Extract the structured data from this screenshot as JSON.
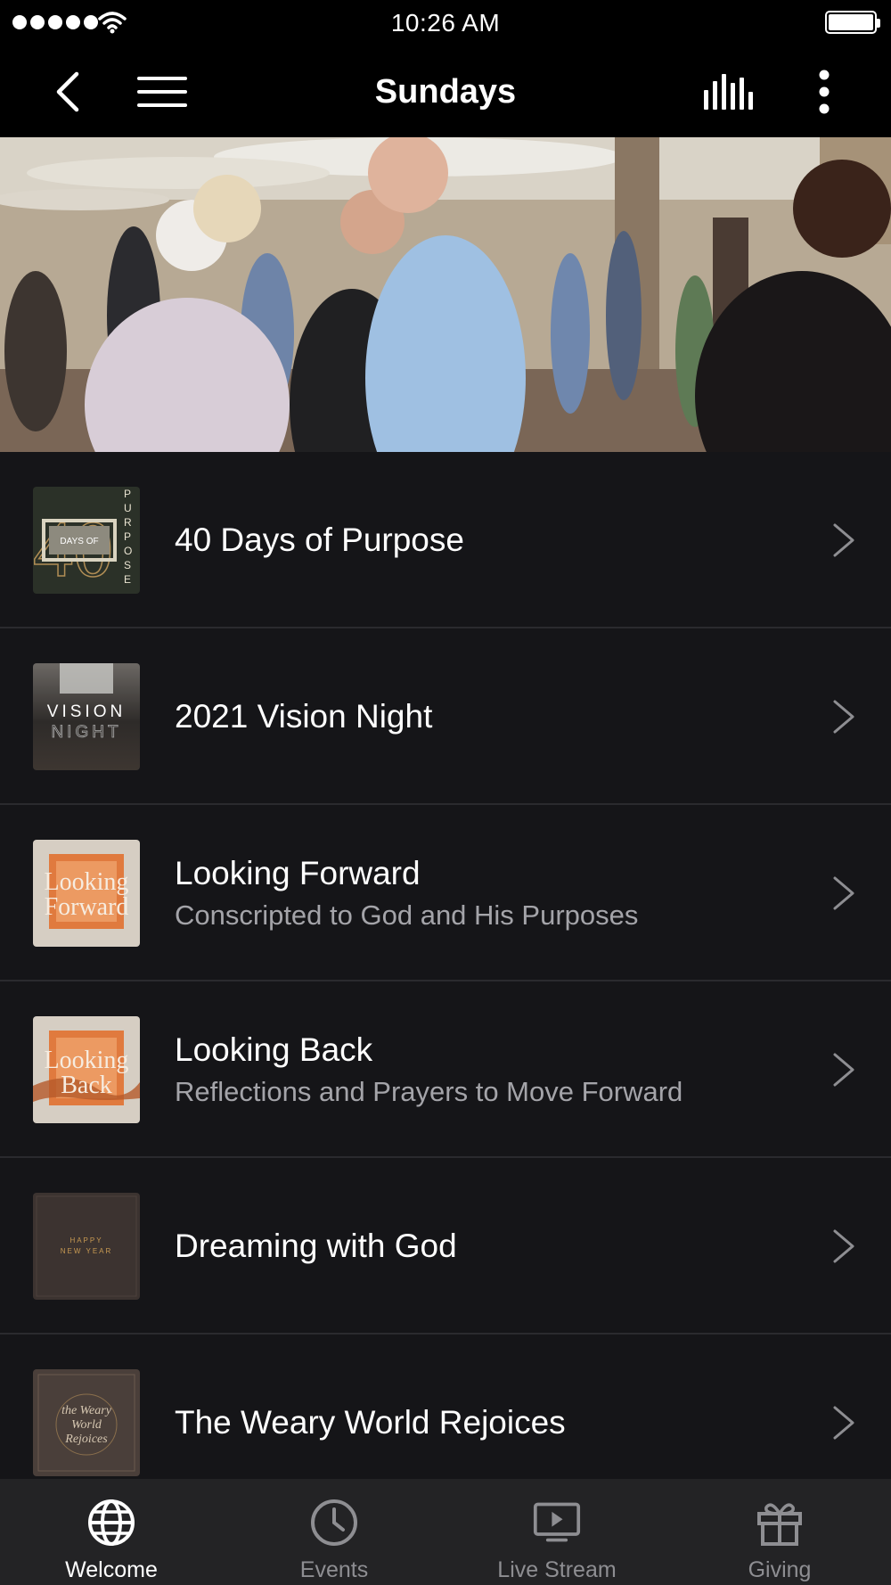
{
  "status_bar": {
    "time": "10:26 AM"
  },
  "nav": {
    "title": "Sundays"
  },
  "list": [
    {
      "title": "40 Days of Purpose",
      "subtitle": "",
      "thumb_text": [
        "DAYS OF",
        "PURPOSE"
      ]
    },
    {
      "title": "2021 Vision Night",
      "subtitle": "",
      "thumb_text": [
        "VISION",
        "NIGHT"
      ]
    },
    {
      "title": "Looking Forward",
      "subtitle": "Conscripted to God and His Purposes",
      "thumb_text": [
        "Looking",
        "Forward"
      ]
    },
    {
      "title": "Looking Back",
      "subtitle": "Reflections and Prayers to Move Forward",
      "thumb_text": [
        "Looking",
        "Back"
      ]
    },
    {
      "title": "Dreaming with God",
      "subtitle": "",
      "thumb_text": [
        "HAPPY",
        "NEW YEAR"
      ]
    },
    {
      "title": "The Weary World Rejoices",
      "subtitle": "",
      "thumb_text": [
        "the Weary",
        "World",
        "Rejoices"
      ]
    }
  ],
  "tabs": [
    {
      "label": "Welcome",
      "icon": "globe-icon",
      "active": true
    },
    {
      "label": "Events",
      "icon": "clock-icon",
      "active": false
    },
    {
      "label": "Live Stream",
      "icon": "play-screen-icon",
      "active": false
    },
    {
      "label": "Giving",
      "icon": "gift-icon",
      "active": false
    }
  ],
  "colors": {
    "background": "#151518",
    "bar": "#000000",
    "tab_bar": "#232325",
    "subtitle": "#a4a4a9",
    "inactive_tab": "#8e8e92"
  }
}
